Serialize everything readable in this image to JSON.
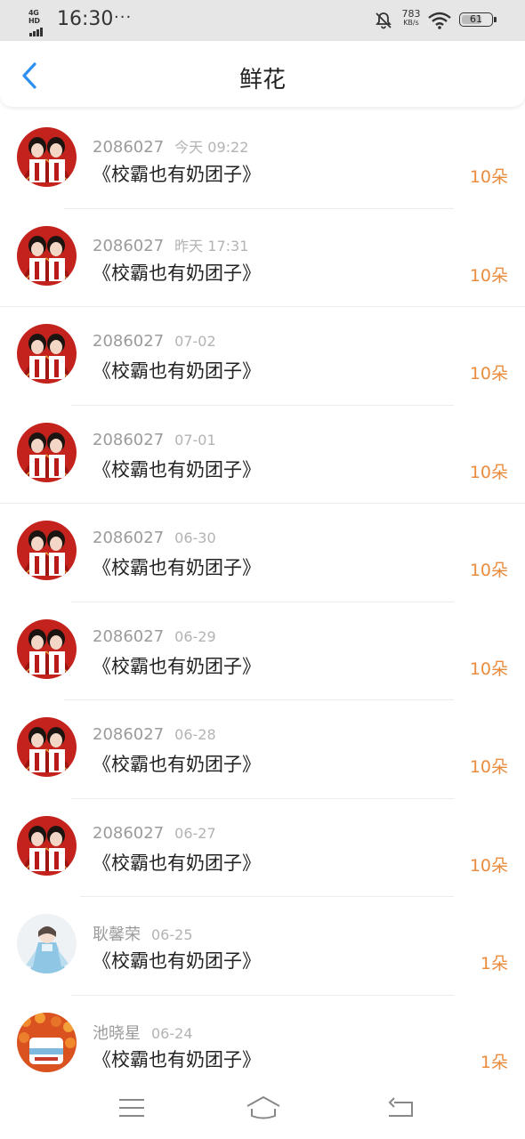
{
  "status_bar": {
    "network": "4G HD",
    "time": "16:30",
    "dots": "···",
    "speed_value": "783",
    "speed_unit": "KB/s",
    "battery": "61"
  },
  "header": {
    "title": "鲜花",
    "back_icon": "chevron-left-icon"
  },
  "colors": {
    "accent": "#2d8ff0",
    "count": "#ea8c3e",
    "name": "#9b9b9b",
    "text": "#222222"
  },
  "items": [
    {
      "user": "2086027",
      "date": "今天 09:22",
      "book": "《校霸也有奶团子》",
      "count": "10朵",
      "avatar": "couple-red-avatar"
    },
    {
      "user": "2086027",
      "date": "昨天 17:31",
      "book": "《校霸也有奶团子》",
      "count": "10朵",
      "avatar": "couple-red-avatar"
    },
    {
      "user": "2086027",
      "date": "07-02",
      "book": "《校霸也有奶团子》",
      "count": "10朵",
      "avatar": "couple-red-avatar"
    },
    {
      "user": "2086027",
      "date": "07-01",
      "book": "《校霸也有奶团子》",
      "count": "10朵",
      "avatar": "couple-red-avatar"
    },
    {
      "user": "2086027",
      "date": "06-30",
      "book": "《校霸也有奶团子》",
      "count": "10朵",
      "avatar": "couple-red-avatar"
    },
    {
      "user": "2086027",
      "date": "06-29",
      "book": "《校霸也有奶团子》",
      "count": "10朵",
      "avatar": "couple-red-avatar"
    },
    {
      "user": "2086027",
      "date": "06-28",
      "book": "《校霸也有奶团子》",
      "count": "10朵",
      "avatar": "couple-red-avatar"
    },
    {
      "user": "2086027",
      "date": "06-27",
      "book": "《校霸也有奶团子》",
      "count": "10朵",
      "avatar": "couple-red-avatar"
    },
    {
      "user": "耿馨荣",
      "date": "06-25",
      "book": "《校霸也有奶团子》",
      "count": "1朵",
      "avatar": "blue-figure-avatar"
    },
    {
      "user": "池晓星",
      "date": "06-24",
      "book": "《校霸也有奶团子》",
      "count": "1朵",
      "avatar": "orange-flowers-avatar"
    }
  ],
  "system_nav": {
    "menu_icon": "menu-icon",
    "home_icon": "home-icon",
    "back_icon": "back-icon"
  }
}
